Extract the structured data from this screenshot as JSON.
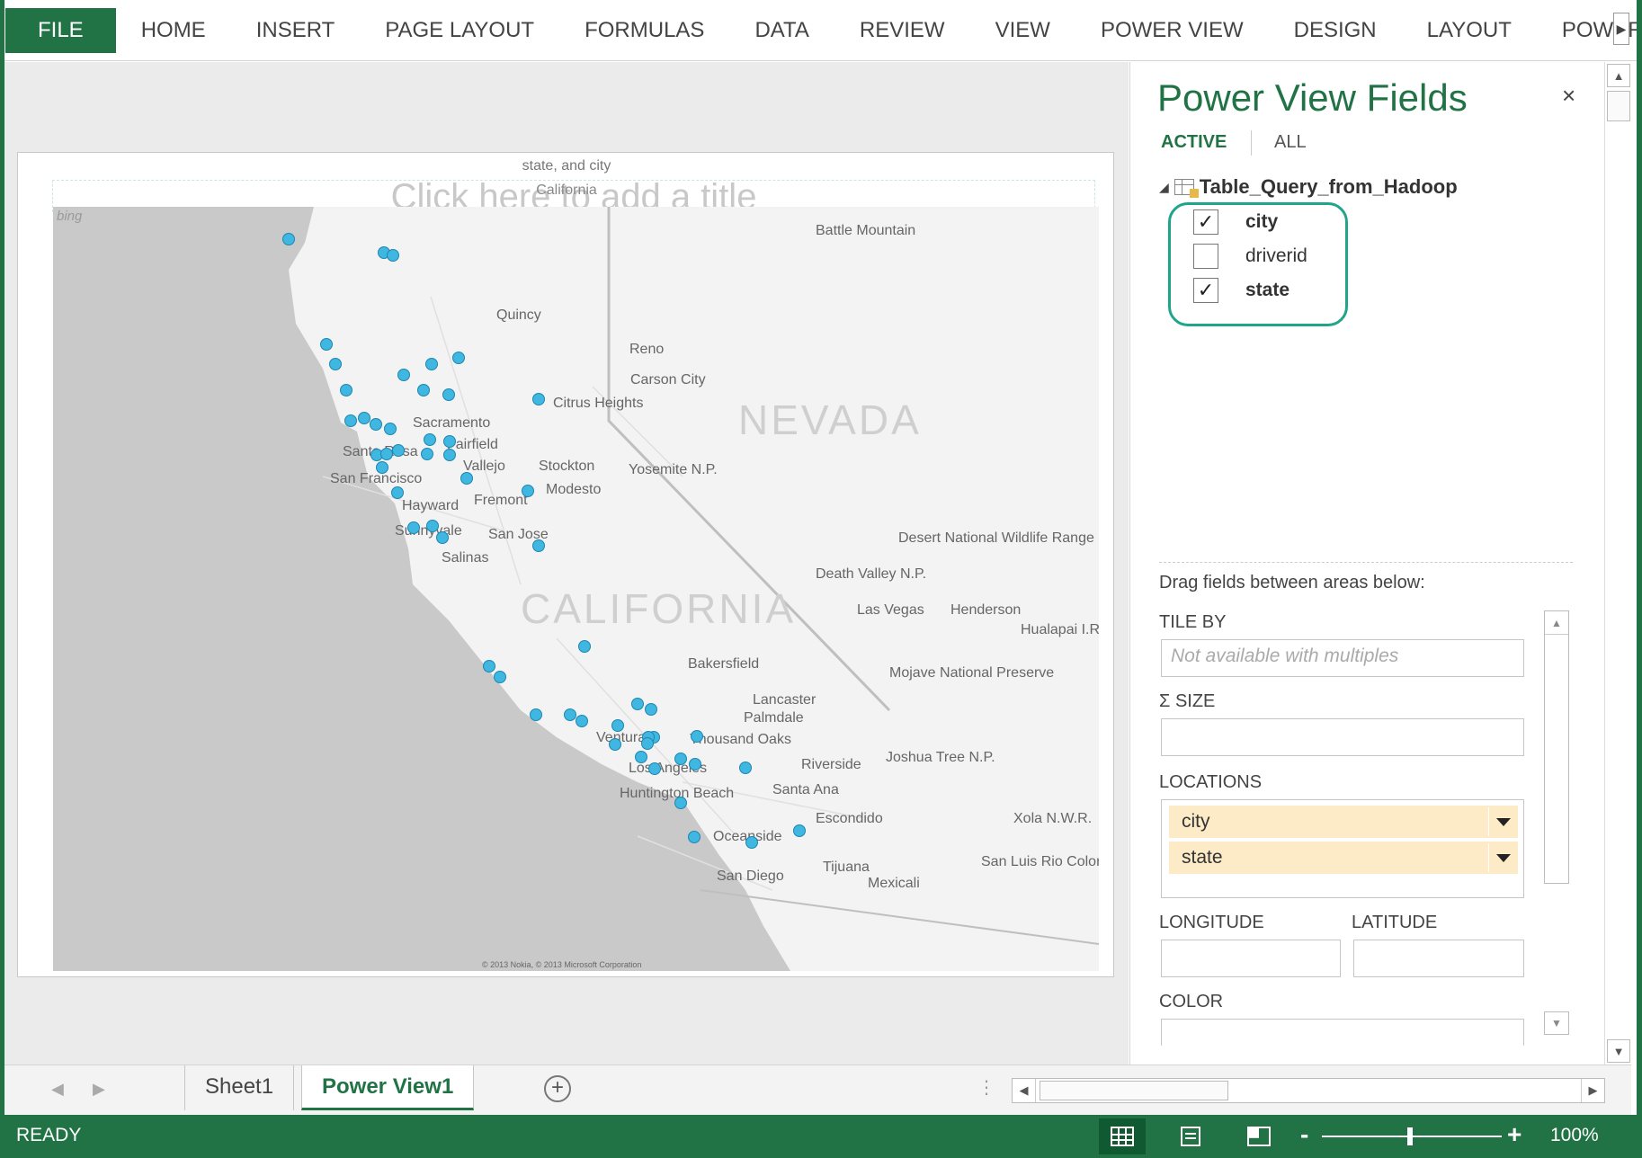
{
  "ribbon": {
    "tabs": [
      "FILE",
      "HOME",
      "INSERT",
      "PAGE LAYOUT",
      "FORMULAS",
      "DATA",
      "REVIEW",
      "VIEW",
      "POWER VIEW",
      "DESIGN",
      "LAYOUT",
      "POWERPIVO"
    ],
    "active_tab": "FILE"
  },
  "view": {
    "title_placeholder": "Click here to add a title",
    "subtitle": "state, and city",
    "filter_label": "California",
    "bing_logo": "bing",
    "copyright": "© 2013 Nokia, © 2013 Microsoft Corporation"
  },
  "map": {
    "region_labels": [
      "NEVADA",
      "CALIFORNIA"
    ],
    "city_labels": [
      "Battle Mountain",
      "Quincy",
      "Reno",
      "Carson City",
      "Citrus Heights",
      "Sacramento",
      "Fairfield",
      "Santa Rosa",
      "San Francisco",
      "Vallejo",
      "Stockton",
      "Modesto",
      "Yosemite N.P.",
      "Fremont",
      "Hayward",
      "Sunnyvale",
      "San Jose",
      "Salinas",
      "Las Vegas",
      "Henderson",
      "Death Valley N.P.",
      "Desert National Wildlife Range",
      "Hualapai I.R.",
      "Bakersfield",
      "Mojave National Preserve",
      "Lancaster",
      "Palmdale",
      "Ventura",
      "Thousand Oaks",
      "Riverside",
      "Los Angeles",
      "Santa Ana",
      "Joshua Tree N.P.",
      "Huntington Beach",
      "Escondido",
      "Oceanside",
      "Xola N.W.R.",
      "San Diego",
      "Tijuana",
      "Mexicali",
      "San Luis Rio Colorado"
    ],
    "point_color": "#3fb7e0",
    "point_count": 54
  },
  "panel": {
    "title": "Power View Fields",
    "close": "×",
    "tabs": {
      "active": "ACTIVE",
      "all": "ALL"
    },
    "table_name": "Table_Query_from_Hadoop",
    "fields": [
      {
        "name": "city",
        "checked": "✓"
      },
      {
        "name": "driverid",
        "checked": ""
      },
      {
        "name": "state",
        "checked": "✓"
      }
    ],
    "drag_hint": "Drag fields between areas below:",
    "areas": {
      "tile_by": "TILE BY",
      "tile_by_placeholder": "Not available with multiples",
      "size": "SIZE",
      "size_symbol": "Σ",
      "locations": "LOCATIONS",
      "location_items": [
        "city",
        "state"
      ],
      "longitude": "LONGITUDE",
      "latitude": "LATITUDE",
      "color": "COLOR"
    },
    "highlight_color": "#20a58c"
  },
  "sheets": {
    "tabs": [
      "Sheet1",
      "Power View1"
    ],
    "active": "Power View1",
    "add_label": "+"
  },
  "status": {
    "text": "READY",
    "zoom": "100%",
    "zoom_minus": "-",
    "zoom_plus": "+"
  },
  "colors": {
    "excel_green": "#217346"
  }
}
